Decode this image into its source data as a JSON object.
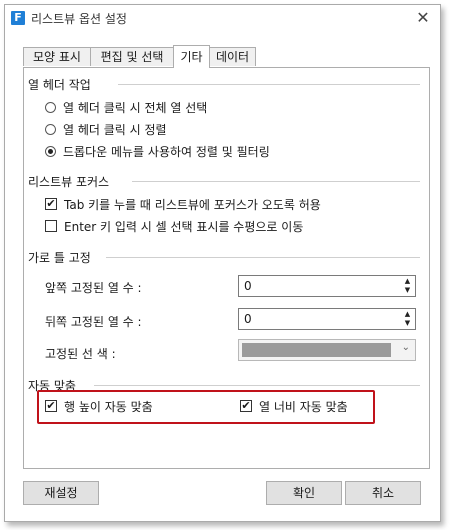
{
  "window": {
    "title": "리스트뷰 옵션 설정",
    "app_icon_letter": "F",
    "close_glyph": "✕"
  },
  "tabs": [
    {
      "label": "모양 표시",
      "active": false
    },
    {
      "label": "편집 및 선택",
      "active": false
    },
    {
      "label": "기타",
      "active": true
    },
    {
      "label": "데이터",
      "active": false
    }
  ],
  "column_header": {
    "title": "열 헤더 작업",
    "options": [
      {
        "label": "열 헤더 클릭 시 전체 열 선택",
        "checked": false
      },
      {
        "label": "열 헤더 클릭 시 정렬",
        "checked": false
      },
      {
        "label": "드롭다운 메뉴를 사용하여 정렬 및 필터링",
        "checked": true
      }
    ]
  },
  "focus": {
    "title": "리스트뷰 포커스",
    "tab_key": {
      "label": "Tab 키를 누를 때 리스트뷰에 포커스가 오도록 허용",
      "checked": true
    },
    "enter_key": {
      "label": "Enter 키 입력 시 셀 선택 표시를 수평으로 이동",
      "checked": false
    }
  },
  "freeze": {
    "title": "가로 틀 고정",
    "front_label": "앞쪽 고정된 열 수 :",
    "front_value": "0",
    "back_label": "뒤쪽 고정된 열 수 :",
    "back_value": "0",
    "line_color_label": "고정된 선 색 :",
    "line_color": "#9a9a9a"
  },
  "autofit": {
    "title": "자동 맞춤",
    "row_height": {
      "label": "행 높이 자동 맞춤",
      "checked": true
    },
    "col_width": {
      "label": "열 너비 자동 맞춤",
      "checked": true
    }
  },
  "buttons": {
    "reset": "재설정",
    "ok": "확인",
    "cancel": "취소"
  },
  "glyphs": {
    "check": "✔",
    "spin_up": "▲",
    "spin_down": "▼",
    "combo_arrow": "⌄"
  },
  "colors": {
    "highlight_border": "#c0121a",
    "app_icon": "#1f7fd6"
  }
}
